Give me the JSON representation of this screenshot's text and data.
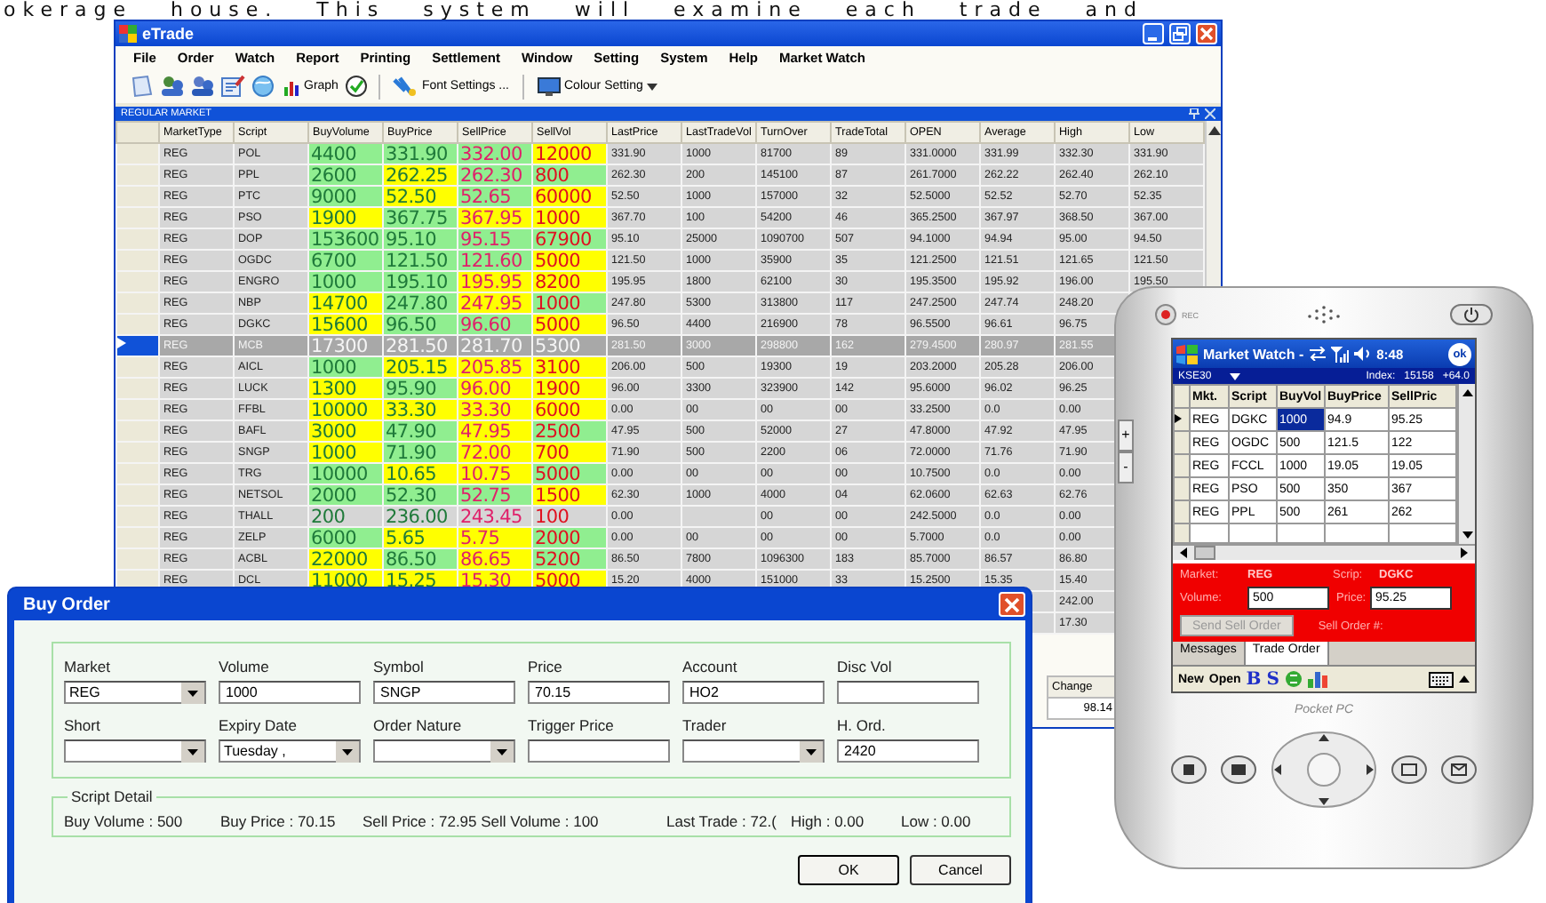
{
  "page_text": "okerage house. This system will examine each trade and",
  "etrade": {
    "title": "eTrade",
    "menu": [
      "File",
      "Order",
      "Watch",
      "Report",
      "Printing",
      "Settlement",
      "Window",
      "Setting",
      "System",
      "Help",
      "Market Watch"
    ],
    "toolbar": [
      "Graph",
      "Font Settings ...",
      "Colour Setting"
    ],
    "panel_title": "REGULAR MARKET",
    "columns": [
      "MarketType",
      "Script",
      "BuyVolume",
      "BuyPrice",
      "SellPrice",
      "SellVol",
      "LastPrice",
      "LastTradeVol",
      "TurnOver",
      "TradeTotal",
      "OPEN",
      "Average",
      "High",
      "Low"
    ],
    "rows": [
      {
        "market": "REG",
        "script": "POL",
        "selected": false,
        "quote": [
          {
            "text": "4400",
            "color": "#90ee90"
          },
          {
            "text": "331.90",
            "color": "#90ee90"
          },
          {
            "text": "332.00",
            "color": "#90ee90"
          },
          {
            "text": "12000",
            "color": "#ffff00"
          }
        ],
        "stats": [
          "331.90",
          "1000",
          "81700",
          "89",
          "331.0000",
          "331.99",
          "332.30",
          "331.90"
        ]
      },
      {
        "market": "REG",
        "script": "PPL",
        "selected": false,
        "quote": [
          {
            "text": "2600",
            "color": "#90ee90"
          },
          {
            "text": "262.25",
            "color": "#ffff00"
          },
          {
            "text": "262.30",
            "color": "#90ee90"
          },
          {
            "text": "800",
            "color": "#90ee90"
          }
        ],
        "stats": [
          "262.30",
          "200",
          "145100",
          "87",
          "261.7000",
          "262.22",
          "262.40",
          "262.10"
        ]
      },
      {
        "market": "REG",
        "script": "PTC",
        "selected": false,
        "quote": [
          {
            "text": "9000",
            "color": "#90ee90"
          },
          {
            "text": "52.50",
            "color": "#ffff00"
          },
          {
            "text": "52.65",
            "color": "#90ee90"
          },
          {
            "text": "60000",
            "color": "#ffff00"
          }
        ],
        "stats": [
          "52.50",
          "1000",
          "157000",
          "32",
          "52.5000",
          "52.52",
          "52.70",
          "52.35"
        ]
      },
      {
        "market": "REG",
        "script": "PSO",
        "selected": false,
        "quote": [
          {
            "text": "1900",
            "color": "#ffff00"
          },
          {
            "text": "367.75",
            "color": "#90ee90"
          },
          {
            "text": "367.95",
            "color": "#ffff00"
          },
          {
            "text": "1000",
            "color": "#ffff00"
          }
        ],
        "stats": [
          "367.70",
          "100",
          "54200",
          "46",
          "365.2500",
          "367.97",
          "368.50",
          "367.00"
        ]
      },
      {
        "market": "REG",
        "script": "DOP",
        "selected": false,
        "quote": [
          {
            "text": "153600",
            "color": "#90ee90"
          },
          {
            "text": "95.10",
            "color": "#90ee90"
          },
          {
            "text": "95.15",
            "color": "#90ee90"
          },
          {
            "text": "67900",
            "color": "#90ee90"
          }
        ],
        "stats": [
          "95.10",
          "25000",
          "1090700",
          "507",
          "94.1000",
          "94.94",
          "95.00",
          "94.50"
        ]
      },
      {
        "market": "REG",
        "script": "OGDC",
        "selected": false,
        "quote": [
          {
            "text": "6700",
            "color": "#90ee90"
          },
          {
            "text": "121.50",
            "color": "#90ee90"
          },
          {
            "text": "121.60",
            "color": "#90ee90"
          },
          {
            "text": "5000",
            "color": "#ffff00"
          }
        ],
        "stats": [
          "121.50",
          "1000",
          "35900",
          "35",
          "121.2500",
          "121.51",
          "121.65",
          "121.50"
        ]
      },
      {
        "market": "REG",
        "script": "ENGRO",
        "selected": false,
        "quote": [
          {
            "text": "1000",
            "color": "#90ee90"
          },
          {
            "text": "195.10",
            "color": "#90ee90"
          },
          {
            "text": "195.95",
            "color": "#ffff00"
          },
          {
            "text": "8200",
            "color": "#ffff00"
          }
        ],
        "stats": [
          "195.95",
          "1800",
          "62100",
          "30",
          "195.3500",
          "195.92",
          "196.00",
          "195.50"
        ]
      },
      {
        "market": "REG",
        "script": "NBP",
        "selected": false,
        "quote": [
          {
            "text": "14700",
            "color": "#ffff00"
          },
          {
            "text": "247.80",
            "color": "#90ee90"
          },
          {
            "text": "247.95",
            "color": "#ffff00"
          },
          {
            "text": "1000",
            "color": "#90ee90"
          }
        ],
        "stats": [
          "247.80",
          "5300",
          "313800",
          "117",
          "247.2500",
          "247.74",
          "248.20"
        ]
      },
      {
        "market": "REG",
        "script": "DGKC",
        "selected": false,
        "quote": [
          {
            "text": "15600",
            "color": "#ffff00"
          },
          {
            "text": "96.50",
            "color": "#90ee90"
          },
          {
            "text": "96.60",
            "color": "#90ee90"
          },
          {
            "text": "5000",
            "color": "#ffff00"
          }
        ],
        "stats": [
          "96.50",
          "4400",
          "216900",
          "78",
          "96.5500",
          "96.61",
          "96.75"
        ]
      },
      {
        "market": "REG",
        "script": "MCB",
        "selected": true,
        "quote": [
          {
            "text": "17300"
          },
          {
            "text": "281.50"
          },
          {
            "text": "281.70"
          },
          {
            "text": "5300"
          }
        ],
        "stats": [
          "281.50",
          "3000",
          "298800",
          "162",
          "279.4500",
          "280.97",
          "281.55"
        ]
      },
      {
        "market": "REG",
        "script": "AICL",
        "selected": false,
        "quote": [
          {
            "text": "1000",
            "color": "#90ee90"
          },
          {
            "text": "205.15",
            "color": "#ffff00"
          },
          {
            "text": "205.85",
            "color": "#ffff00"
          },
          {
            "text": "3100",
            "color": "#ffff00"
          }
        ],
        "stats": [
          "206.00",
          "500",
          "19300",
          "19",
          "203.2000",
          "205.28",
          "206.00"
        ]
      },
      {
        "market": "REG",
        "script": "LUCK",
        "selected": false,
        "quote": [
          {
            "text": "1300",
            "color": "#ffff00"
          },
          {
            "text": "95.90",
            "color": "#90ee90"
          },
          {
            "text": "96.00",
            "color": "#ffff00"
          },
          {
            "text": "1900",
            "color": "#ffff00"
          }
        ],
        "stats": [
          "96.00",
          "3300",
          "323900",
          "142",
          "95.6000",
          "96.02",
          "96.25"
        ]
      },
      {
        "market": "REG",
        "script": "FFBL",
        "selected": false,
        "quote": [
          {
            "text": "10000",
            "color": "#ffff00"
          },
          {
            "text": "33.30",
            "color": "#ffff00"
          },
          {
            "text": "33.30",
            "color": "#ffff00"
          },
          {
            "text": "6000",
            "color": "#ffff00"
          }
        ],
        "stats": [
          "0.00",
          "00",
          "00",
          "00",
          "33.2500",
          "0.0",
          "0.00"
        ]
      },
      {
        "market": "REG",
        "script": "BAFL",
        "selected": false,
        "quote": [
          {
            "text": "3000",
            "color": "#ffff00"
          },
          {
            "text": "47.90",
            "color": "#90ee90"
          },
          {
            "text": "47.95",
            "color": "#ffff00"
          },
          {
            "text": "2500",
            "color": "#90ee90"
          }
        ],
        "stats": [
          "47.95",
          "500",
          "52000",
          "27",
          "47.8000",
          "47.92",
          "47.95"
        ]
      },
      {
        "market": "REG",
        "script": "SNGP",
        "selected": false,
        "quote": [
          {
            "text": "1000",
            "color": "#ffff00"
          },
          {
            "text": "71.90",
            "color": "#90ee90"
          },
          {
            "text": "72.00",
            "color": "#ffff00"
          },
          {
            "text": "700",
            "color": "#ffff00"
          }
        ],
        "stats": [
          "71.90",
          "500",
          "2200",
          "06",
          "72.0000",
          "71.76",
          "71.90"
        ]
      },
      {
        "market": "REG",
        "script": "TRG",
        "selected": false,
        "quote": [
          {
            "text": "10000",
            "color": "#90ee90"
          },
          {
            "text": "10.65",
            "color": "#ffff00"
          },
          {
            "text": "10.75",
            "color": "#ffff00"
          },
          {
            "text": "5000",
            "color": "#90ee90"
          }
        ],
        "stats": [
          "0.00",
          "00",
          "00",
          "00",
          "10.7500",
          "0.0",
          "0.00"
        ]
      },
      {
        "market": "REG",
        "script": "NETSOL",
        "selected": false,
        "quote": [
          {
            "text": "2000",
            "color": "#90ee90"
          },
          {
            "text": "52.30",
            "color": "#90ee90"
          },
          {
            "text": "52.75",
            "color": "#90ee90"
          },
          {
            "text": "1500",
            "color": "#ffff00"
          }
        ],
        "stats": [
          "62.30",
          "1000",
          "4000",
          "04",
          "62.0600",
          "62.63",
          "62.76"
        ]
      },
      {
        "market": "REG",
        "script": "THALL",
        "selected": false,
        "quote": [
          {
            "text": "200"
          },
          {
            "text": "236.00"
          },
          {
            "text": "243.45"
          },
          {
            "text": "100"
          }
        ],
        "stats": [
          "0.00",
          "00",
          "00",
          "242.5000",
          "0.0",
          "0.00"
        ],
        "blank_trade_vol": true
      },
      {
        "market": "REG",
        "script": "ZELP",
        "selected": false,
        "quote": [
          {
            "text": "6000",
            "color": "#90ee90"
          },
          {
            "text": "5.65",
            "color": "#ffff00"
          },
          {
            "text": "5.75",
            "color": "#ffff00"
          },
          {
            "text": "2000",
            "color": "#90ee90"
          }
        ],
        "stats": [
          "0.00",
          "00",
          "00",
          "00",
          "5.7000",
          "0.0",
          "0.00"
        ]
      },
      {
        "market": "REG",
        "script": "ACBL",
        "selected": false,
        "quote": [
          {
            "text": "22000",
            "color": "#ffff00"
          },
          {
            "text": "86.50",
            "color": "#90ee90"
          },
          {
            "text": "86.65",
            "color": "#ffff00"
          },
          {
            "text": "5200",
            "color": "#90ee90"
          }
        ],
        "stats": [
          "86.50",
          "7800",
          "1096300",
          "183",
          "85.7000",
          "86.57",
          "86.80"
        ]
      },
      {
        "market": "REG",
        "script": "DCL",
        "selected": false,
        "quote": [
          {
            "text": "11000",
            "color": "#ffff00"
          },
          {
            "text": "15.25",
            "color": "#ffff00"
          },
          {
            "text": "15.30",
            "color": "#ffff00"
          },
          {
            "text": "5000",
            "color": "#ffff00"
          }
        ],
        "stats": [
          "15.20",
          "4000",
          "151000",
          "33",
          "15.2500",
          "15.35",
          "15.40"
        ]
      }
    ],
    "hidden_rows": [
      {
        "high": "242.00"
      },
      {
        "high": "17.30"
      }
    ],
    "footer": {
      "column": "Change",
      "value": "98.14"
    }
  },
  "buy_order": {
    "title": "Buy Order",
    "fields": [
      {
        "label": "Market",
        "value": "REG",
        "kind": "combo"
      },
      {
        "label": "Volume",
        "value": "1000",
        "kind": "text"
      },
      {
        "label": "Symbol",
        "value": "SNGP",
        "kind": "text"
      },
      {
        "label": "Price",
        "value": "70.15",
        "kind": "text"
      },
      {
        "label": "Account",
        "value": "HO2",
        "kind": "text"
      },
      {
        "label": "Disc Vol",
        "kind": "text"
      },
      {
        "label": "Short",
        "kind": "combo"
      },
      {
        "label": "Expiry Date",
        "value": "Tuesday ,",
        "kind": "combo"
      },
      {
        "label": "Order Nature",
        "kind": "combo"
      },
      {
        "label": "Trigger Price",
        "kind": "text"
      },
      {
        "label": "Trader",
        "kind": "combo"
      },
      {
        "label": "H. Ord.",
        "value": "2420",
        "kind": "text"
      }
    ],
    "detail_title": "Script Detail",
    "detail": [
      "Buy Volume : 500",
      "Buy Price : 70.15",
      "Sell Price : 72.95 Sell Volume : 100",
      "Last Trade : 72.(",
      "High : 0.00",
      "Low : 0.00"
    ],
    "buttons": [
      "OK",
      "Cancel"
    ]
  },
  "pda": {
    "side_buttons": [
      "+",
      "-"
    ],
    "rec": "REC",
    "title": "Market Watch -",
    "time": "8:48",
    "ok": "ok",
    "list": "KSE30",
    "index_label": "Index:",
    "index": "15158",
    "change": "+64.0",
    "columns": [
      "Mkt.",
      "Script",
      "BuyVol",
      "BuyPrice",
      "SellPric"
    ],
    "rows": [
      {
        "cells": [
          "REG",
          "DGKC",
          "1000",
          "94.9",
          "95.25"
        ],
        "selected": true
      },
      {
        "cells": [
          "REG",
          "OGDC",
          "500",
          "121.5",
          "122"
        ],
        "selected": false
      },
      {
        "cells": [
          "REG",
          "FCCL",
          "1000",
          "19.05",
          "19.05"
        ],
        "selected": false
      },
      {
        "cells": [
          "REG",
          "PSO",
          "500",
          "350",
          "367"
        ],
        "selected": false
      },
      {
        "cells": [
          "REG",
          "PPL",
          "500",
          "261",
          "262"
        ],
        "selected": false
      }
    ],
    "market_label": "Market:",
    "market": "REG",
    "scrip_label": "Scrip:",
    "scrip": "DGKC",
    "volume_label": "Volume:",
    "volume": "500",
    "price_label": "Price:",
    "price": "95.25",
    "send_button": {
      "label": "Send Sell Order",
      "disabled": true
    },
    "order_no_label": "Sell Order #:",
    "tabs": [
      {
        "label": "Messages",
        "selected": false
      },
      {
        "label": "Trade Order",
        "selected": true
      }
    ],
    "menu": [
      "New",
      "Open"
    ],
    "buy_key": "B",
    "sell_key": "S",
    "brand": "Pocket PC"
  }
}
